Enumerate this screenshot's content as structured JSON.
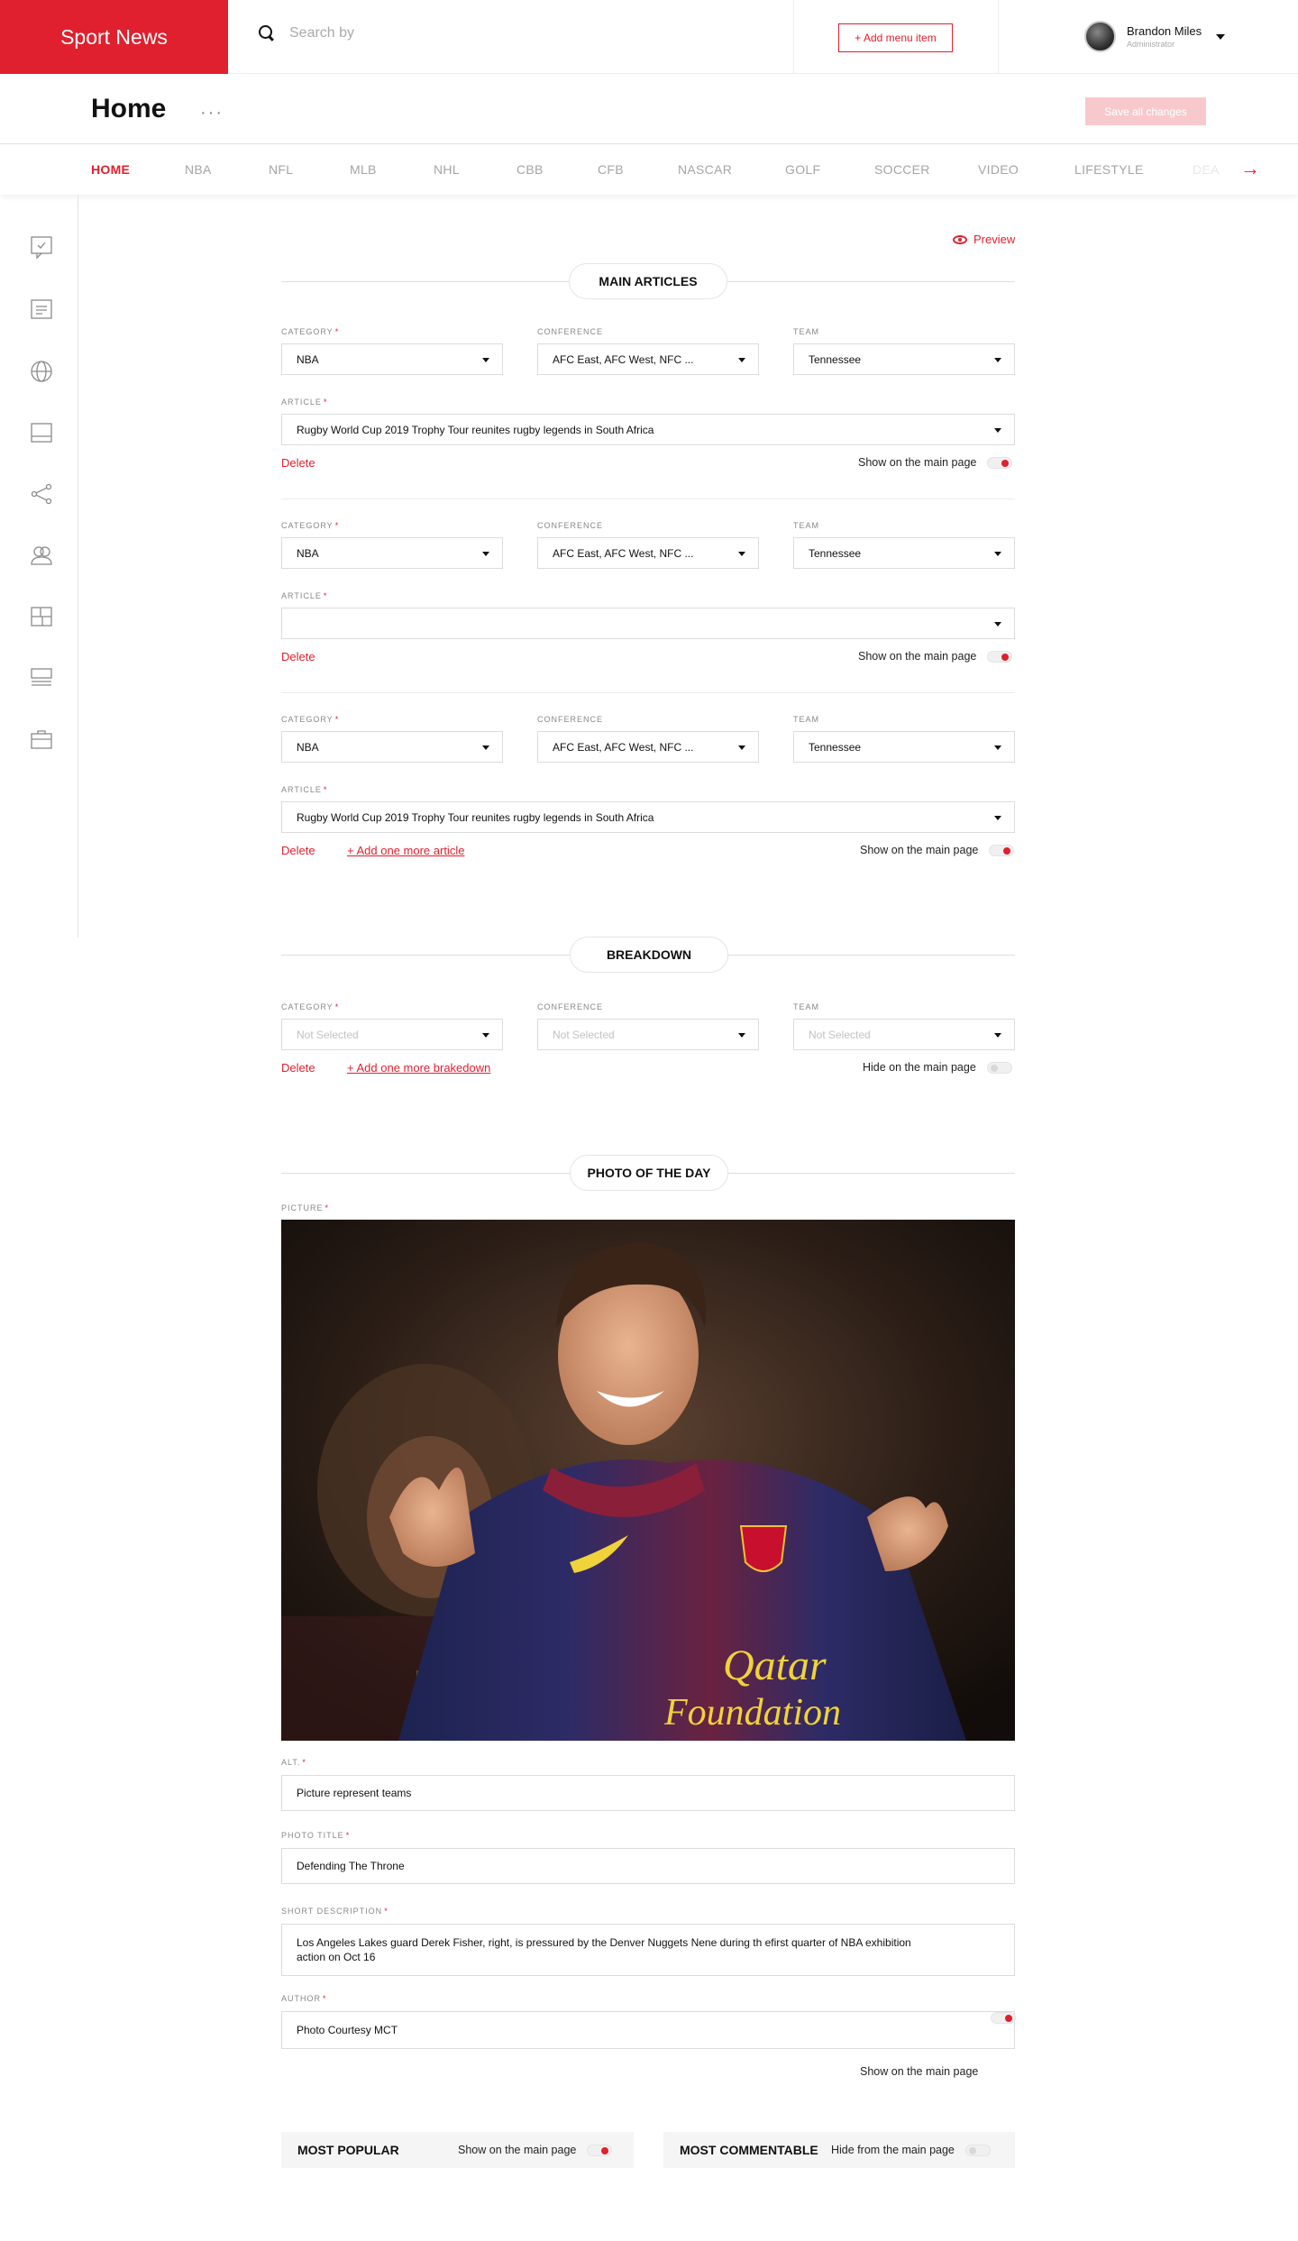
{
  "brand": {
    "name": "Sport News",
    "accent": "#e0202e"
  },
  "search": {
    "placeholder": "Search by",
    "icon": "search-icon"
  },
  "header": {
    "add_menu_item": "+ Add menu item"
  },
  "user": {
    "name": "Brandon Miles",
    "role": "Administrator"
  },
  "page": {
    "title": "Home",
    "more": "···",
    "save_all": "Save all changes"
  },
  "tabs": [
    "HOME",
    "NBA",
    "NFL",
    "MLB",
    "NHL",
    "CBB",
    "CFB",
    "NASCAR",
    "GOLF",
    "SOCCER",
    "VIDEO",
    "LIFESTYLE",
    "DEA"
  ],
  "sidebar": {
    "icons": [
      "comment-check-icon",
      "document-icon",
      "globe-icon",
      "layout-icon",
      "share-icon",
      "users-icon",
      "grid-icon",
      "list-icon",
      "briefcase-icon"
    ]
  },
  "preview_label": "Preview",
  "main_articles": {
    "title": "MAIN ARTICLES",
    "labels": {
      "category": "CATEGORY",
      "conference": "CONFERENCE",
      "team": "TEAM",
      "article": "ARTICLE"
    },
    "blocks": [
      {
        "category": "NBA",
        "conference": "AFC East, AFC West, NFC ...",
        "team": "Tennessee",
        "article": "Rugby World Cup 2019 Trophy Tour reunites rugby legends in South Africa",
        "delete": "Delete",
        "toggle_label": "Show on the main page",
        "toggle_on": true
      },
      {
        "category": "NBA",
        "conference": "AFC East, AFC West, NFC ...",
        "team": "Tennessee",
        "article": "",
        "delete": "Delete",
        "toggle_label": "Show on the main page",
        "toggle_on": true
      },
      {
        "category": "NBA",
        "conference": "AFC East, AFC West, NFC ...",
        "team": "Tennessee",
        "article": "Rugby World Cup 2019 Trophy Tour reunites rugby legends in South Africa",
        "delete": "Delete",
        "add_more": "+ Add one more article",
        "toggle_label": "Show on the main page",
        "toggle_on": true
      }
    ]
  },
  "breakdown": {
    "title": "BREAKDOWN",
    "category": "Not Selected",
    "conference": "Not Selected",
    "team": "Not Selected",
    "delete": "Delete",
    "add_more": "+ Add one more brakedown",
    "toggle_label": "Hide on the main page",
    "toggle_on": false
  },
  "photo_of_day": {
    "title": "PHOTO OF THE DAY",
    "picture_label": "PICTURE",
    "jersey_text_1": "Qatar",
    "jersey_text_2": "Foundation",
    "alt_label": "ALT.",
    "alt": "Picture represent teams",
    "photo_title_label": "PHOTO TITLE",
    "photo_title": "Defending The Throne",
    "short_description_label": "SHORT DESCRIPTION",
    "short_description": "Los Angeles Lakes guard Derek Fisher, right, is pressured by the Denver Nuggets Nene during th efirst quarter of NBA exhibition action on Oct 16",
    "author_label": "AUTHOR",
    "author": "Photo Courtesy MCT",
    "toggle_label": "Show on the main page",
    "toggle_on": true
  },
  "most_popular": {
    "title": "MOST POPULAR",
    "toggle_label": "Show on the main page",
    "toggle_on": true
  },
  "most_commentable": {
    "title": "MOST COMMENTABLE",
    "toggle_label": "Hide from the main page",
    "toggle_on": false
  }
}
